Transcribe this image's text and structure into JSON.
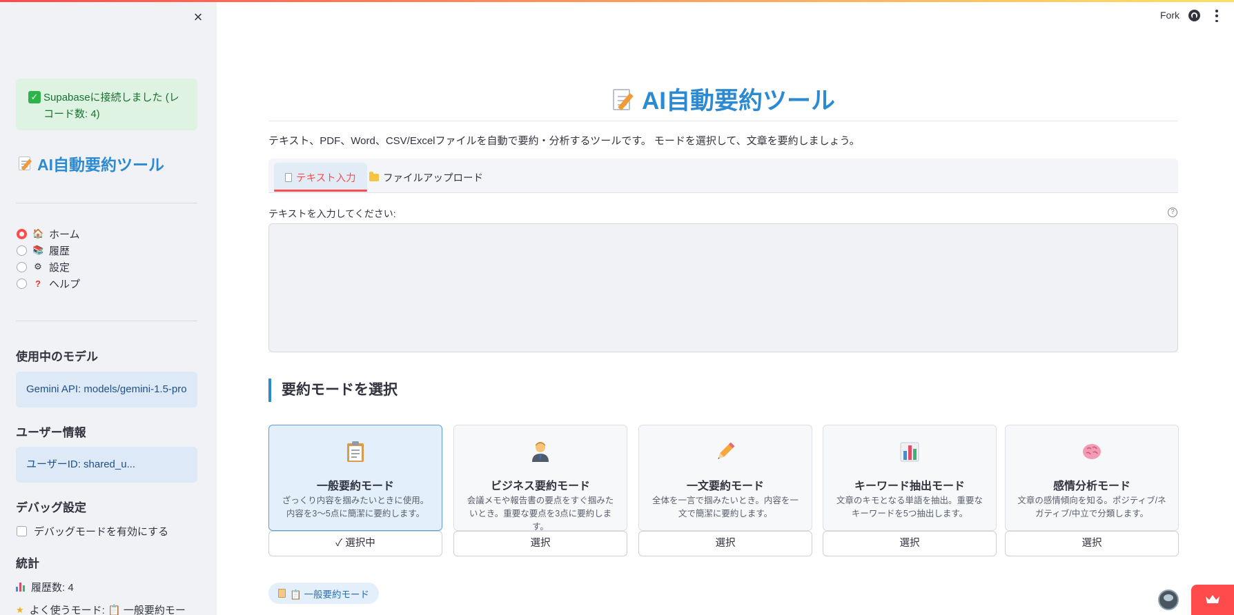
{
  "header": {
    "fork_label": "Fork"
  },
  "sidebar": {
    "success_message": "Supabaseに接続しました (レコード数: 4)",
    "app_title": "AI自動要約ツール",
    "nav": [
      {
        "label": "ホーム",
        "icon": "house-icon",
        "selected": true
      },
      {
        "label": "履歴",
        "icon": "books-icon",
        "selected": false
      },
      {
        "label": "設定",
        "icon": "gear-icon",
        "selected": false
      },
      {
        "label": "ヘルプ",
        "icon": "question-icon",
        "selected": false
      }
    ],
    "model_heading": "使用中のモデル",
    "model_value": "Gemini API: models/gemini-1.5-pro",
    "user_heading": "ユーザー情報",
    "user_value": "ユーザーID: shared_u...",
    "debug_heading": "デバッグ設定",
    "debug_checkbox_label": "デバッグモードを有効にする",
    "stats_heading": "統計",
    "stat_history": "履歴数: 4",
    "stat_frequent_mode": "よく使うモード: 📋 一般要約モー"
  },
  "main": {
    "title": "AI自動要約ツール",
    "description": "テキスト、PDF、Word、CSV/Excelファイルを自動で要約・分析するツールです。 モードを選択して、文章を要約しましょう。",
    "tabs": [
      {
        "label": "テキスト入力",
        "icon": "document-icon",
        "active": true
      },
      {
        "label": "ファイルアップロード",
        "icon": "folder-icon",
        "active": false
      }
    ],
    "text_input_label": "テキストを入力してください:",
    "text_input_value": "",
    "mode_section_heading": "要約モードを選択",
    "modes": [
      {
        "title": "一般要約モード",
        "desc": "ざっくり内容を掴みたいときに使用。内容を3〜5点に簡潔に要約します。",
        "icon": "clipboard-icon",
        "button": "✓ 選択中",
        "selected": true
      },
      {
        "title": "ビジネス要約モード",
        "desc": "会議メモや報告書の要点をすぐ掴みたいとき。重要な要点を3点に要約します。",
        "icon": "businessperson-icon",
        "button": "選択",
        "selected": false
      },
      {
        "title": "一文要約モード",
        "desc": "全体を一言で掴みたいとき。内容を一文で簡潔に要約します。",
        "icon": "pencil-icon",
        "button": "選択",
        "selected": false
      },
      {
        "title": "キーワード抽出モード",
        "desc": "文章のキモとなる単語を抽出。重要なキーワードを5つ抽出します。",
        "icon": "bar-chart-icon",
        "button": "選択",
        "selected": false
      },
      {
        "title": "感情分析モード",
        "desc": "文章の感情傾向を知る。ポジティブ/ネガティブ/中立で分類します。",
        "icon": "brain-icon",
        "button": "選択",
        "selected": false
      }
    ],
    "current_mode_badge": "📋 一般要約モード"
  },
  "colors": {
    "accent_blue": "#2c8ad3",
    "accent_red": "#ff4b4b",
    "success_bg": "#dff3e3",
    "info_bg": "#dde9f7"
  }
}
